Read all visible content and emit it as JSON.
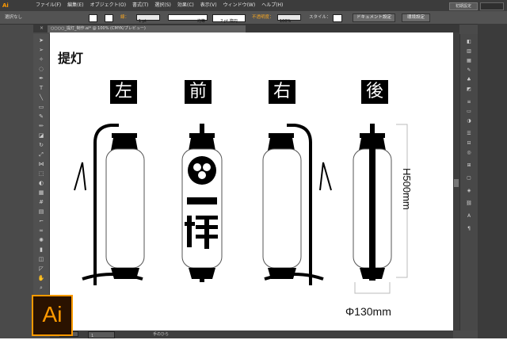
{
  "app": {
    "logo": "Ai",
    "menus": [
      "ファイル(F)",
      "編集(E)",
      "オブジェクト(O)",
      "書式(T)",
      "選択(S)",
      "効果(C)",
      "表示(V)",
      "ウィンドウ(W)",
      "ヘルプ(H)"
    ],
    "workspace": "初期設定"
  },
  "control": {
    "selection": "選択なし",
    "stroke_label": "線：",
    "stroke_weight": "1 pt",
    "uniform": "均等",
    "brush": "2 pt 楕円",
    "opacity_label": "不透明度：",
    "opacity": "100%",
    "style_label": "スタイル：",
    "doc_setup": "ドキュメント設定",
    "prefs": "環境設定"
  },
  "document": {
    "tab_title": "○○○○_提灯_制作.ai* @ 100% (CMYK/プレビュー)"
  },
  "artwork": {
    "title": "提灯",
    "labels": [
      "左",
      "前",
      "右",
      "後"
    ],
    "emblem_text": "一様",
    "height_dim": "H500mm",
    "width_dim": "Φ130mm"
  },
  "status": {
    "zoom": "100%",
    "page": "1",
    "tool": "手のひら"
  },
  "badge": {
    "text": "Ai",
    "color": "#ff9a00"
  },
  "colors": {
    "accent": "#ff9a00",
    "ui_bg": "#4a4a4a",
    "canvas": "#ffffff"
  }
}
